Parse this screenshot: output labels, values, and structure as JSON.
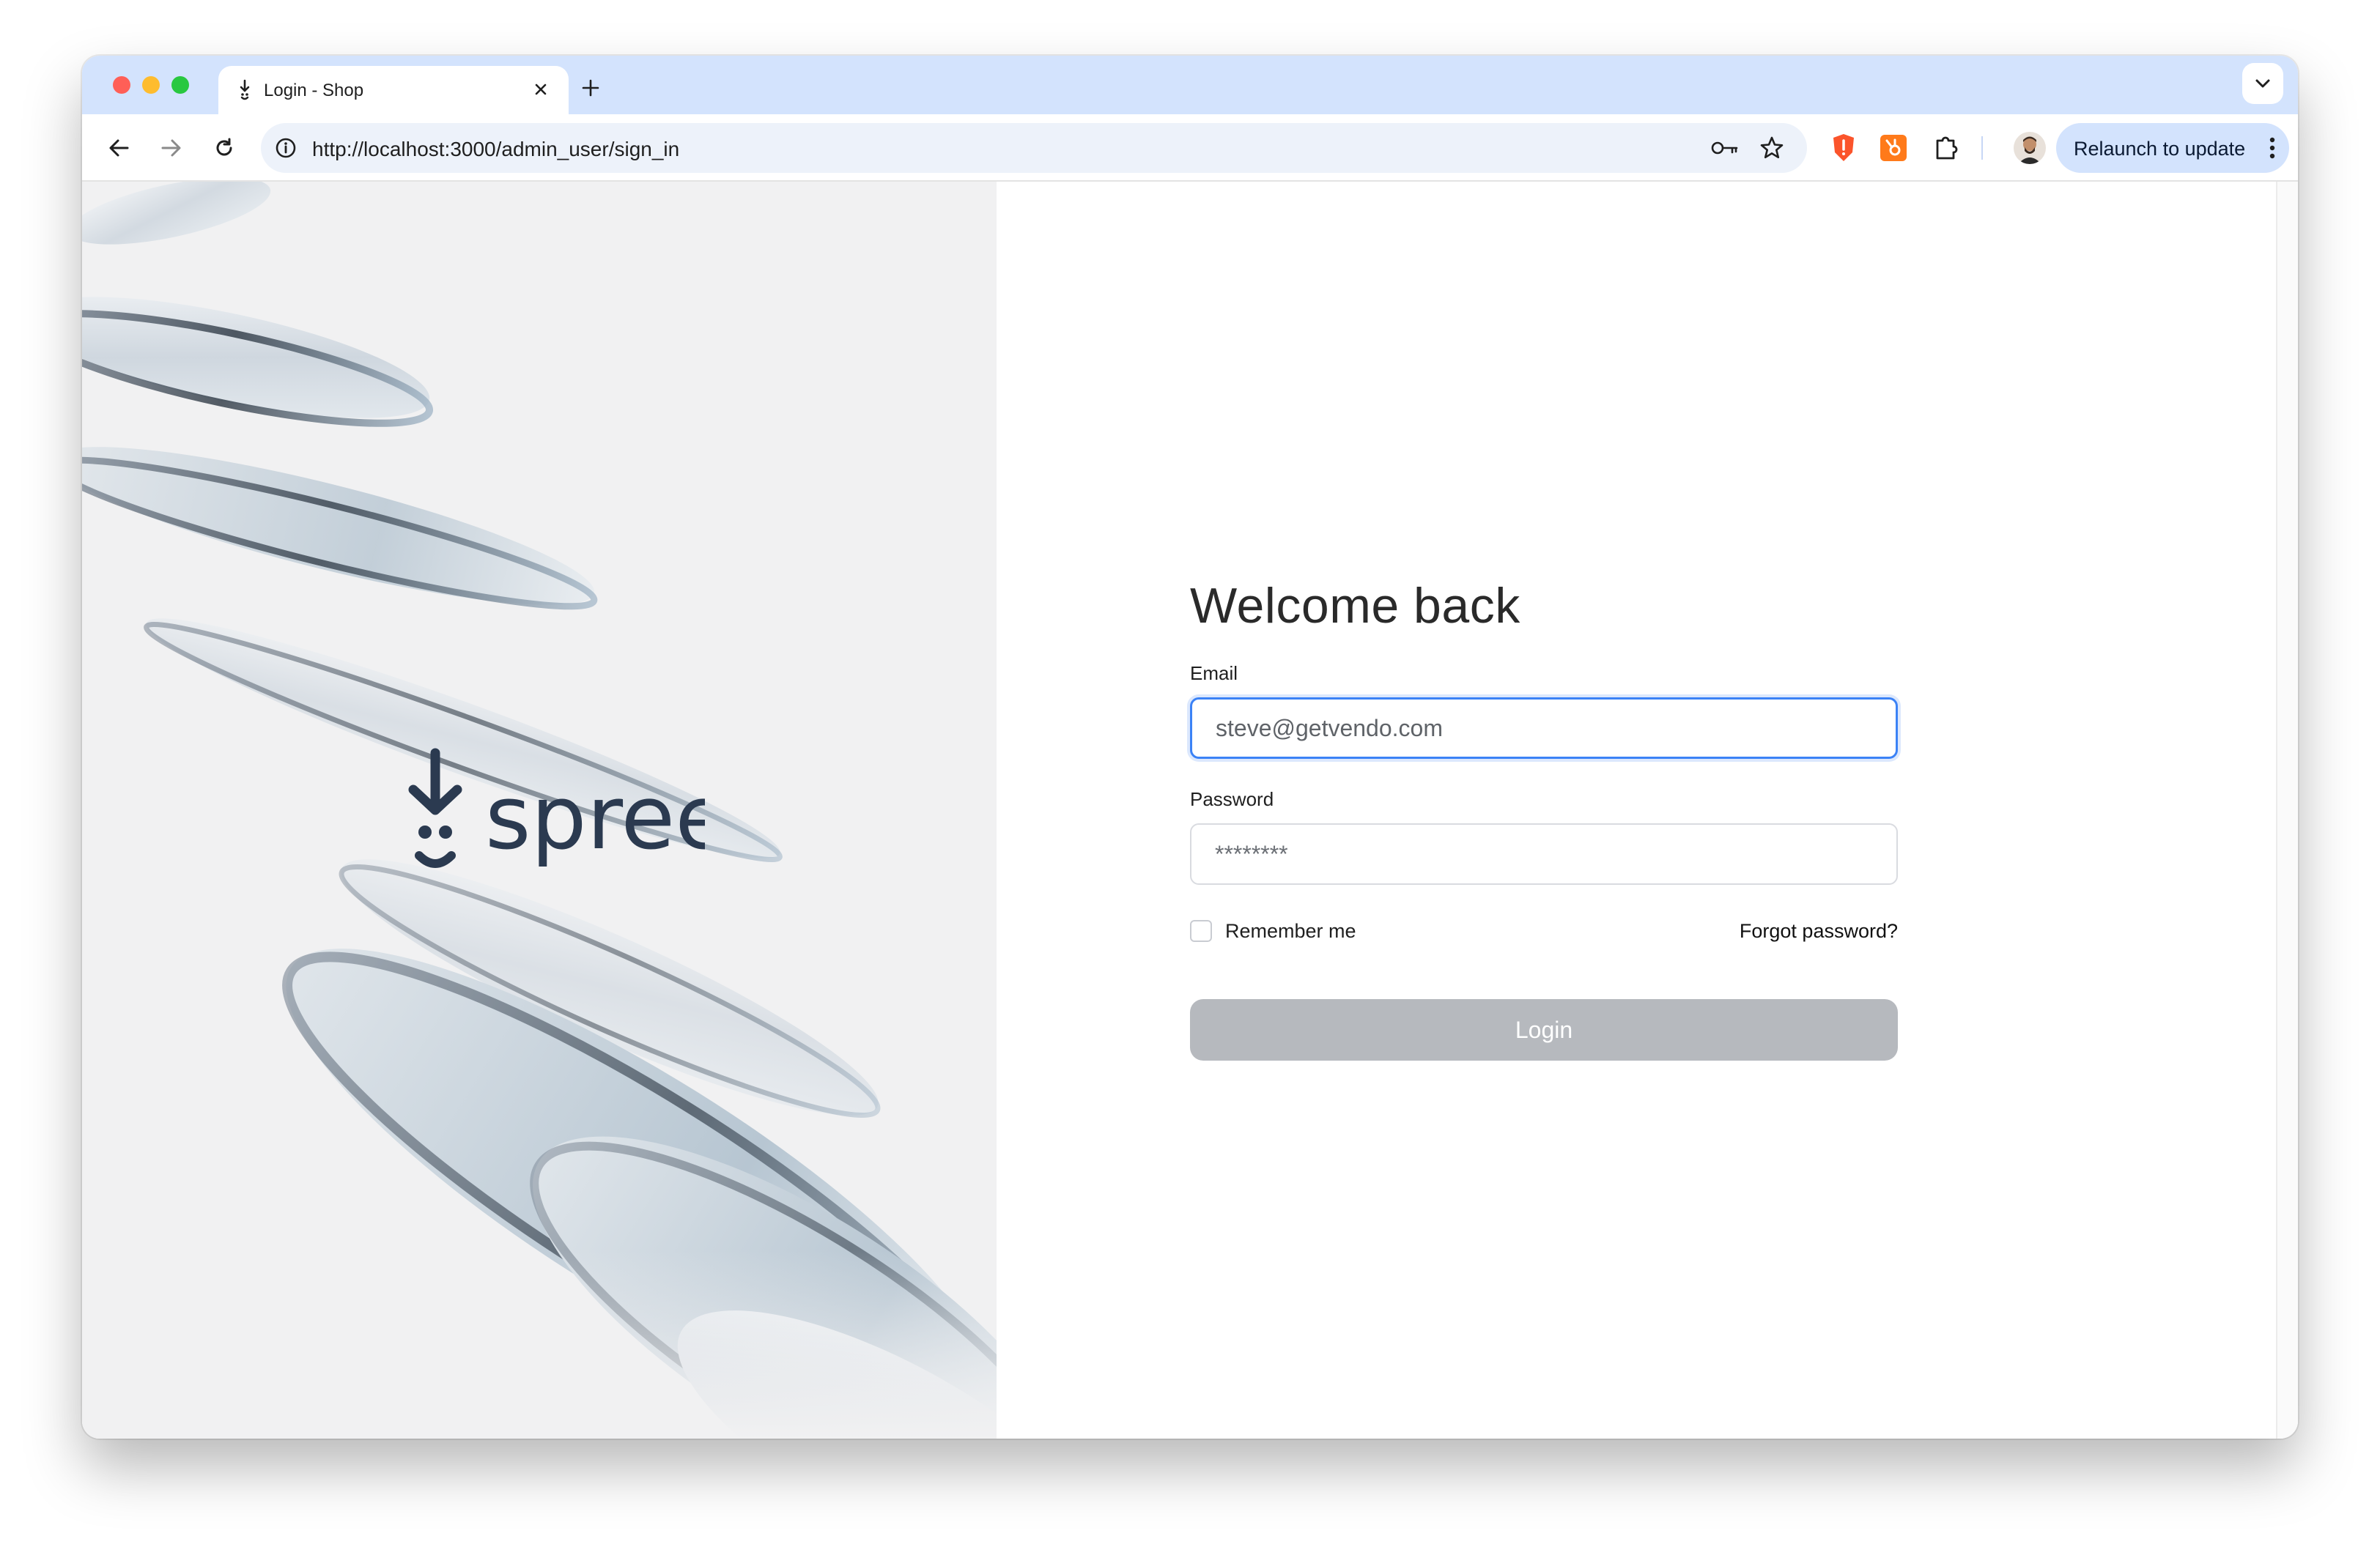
{
  "browser": {
    "tab_title": "Login - Shop",
    "url": "http://localhost:3000/admin_user/sign_in",
    "relaunch_label": "Relaunch to update",
    "icons": [
      "back-arrow-icon",
      "forward-arrow-icon",
      "reload-icon",
      "site-info-icon",
      "password-key-icon",
      "bookmark-star-icon",
      "brave-shield-icon",
      "hubspot-extension-icon",
      "extensions-puzzle-icon",
      "profile-avatar",
      "more-menu-icon",
      "tab-search-chevron-icon",
      "new-tab-plus-icon",
      "tab-close-icon"
    ]
  },
  "hero": {
    "logo_text": "spree"
  },
  "login": {
    "heading": "Welcome back",
    "email_label": "Email",
    "email_value": "steve@getvendo.com",
    "password_label": "Password",
    "password_value": "********",
    "remember_label": "Remember me",
    "forgot_label": "Forgot password?",
    "submit_label": "Login"
  },
  "colors": {
    "tabstrip": "#d3e3fd",
    "omnibox": "#edf2fa",
    "focus_ring": "#3b82f6",
    "login_button_disabled": "#b6b9be",
    "brand_navy": "#2b3a50"
  }
}
